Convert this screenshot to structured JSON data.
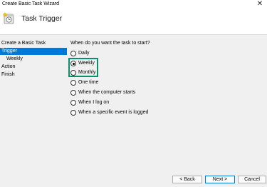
{
  "window": {
    "title": "Create Basic Task Wizard",
    "close_glyph": "✕"
  },
  "header": {
    "title": "Task Trigger",
    "icon": "task-scheduler-icon"
  },
  "steps": [
    {
      "label": "Create a Basic Task",
      "selected": false,
      "indent": false
    },
    {
      "label": "Trigger",
      "selected": true,
      "indent": false
    },
    {
      "label": "Weekly",
      "selected": false,
      "indent": true
    },
    {
      "label": "Action",
      "selected": false,
      "indent": false
    },
    {
      "label": "Finish",
      "selected": false,
      "indent": false
    }
  ],
  "question": "When do you want the task to start?",
  "options": [
    {
      "label": "Daily",
      "checked": false
    },
    {
      "label": "Weekly",
      "checked": true
    },
    {
      "label": "Monthly",
      "checked": false
    },
    {
      "label": "One time",
      "checked": false
    },
    {
      "label": "When the computer starts",
      "checked": false
    },
    {
      "label": "When I log on",
      "checked": false
    },
    {
      "label": "When a specific event is logged",
      "checked": false
    }
  ],
  "buttons": {
    "back": "< Back",
    "next": "Next >",
    "cancel": "Cancel"
  },
  "colors": {
    "selection": "#0078d7",
    "highlight_box": "#0d8f6f",
    "panel_bg": "#f0f0f0"
  }
}
